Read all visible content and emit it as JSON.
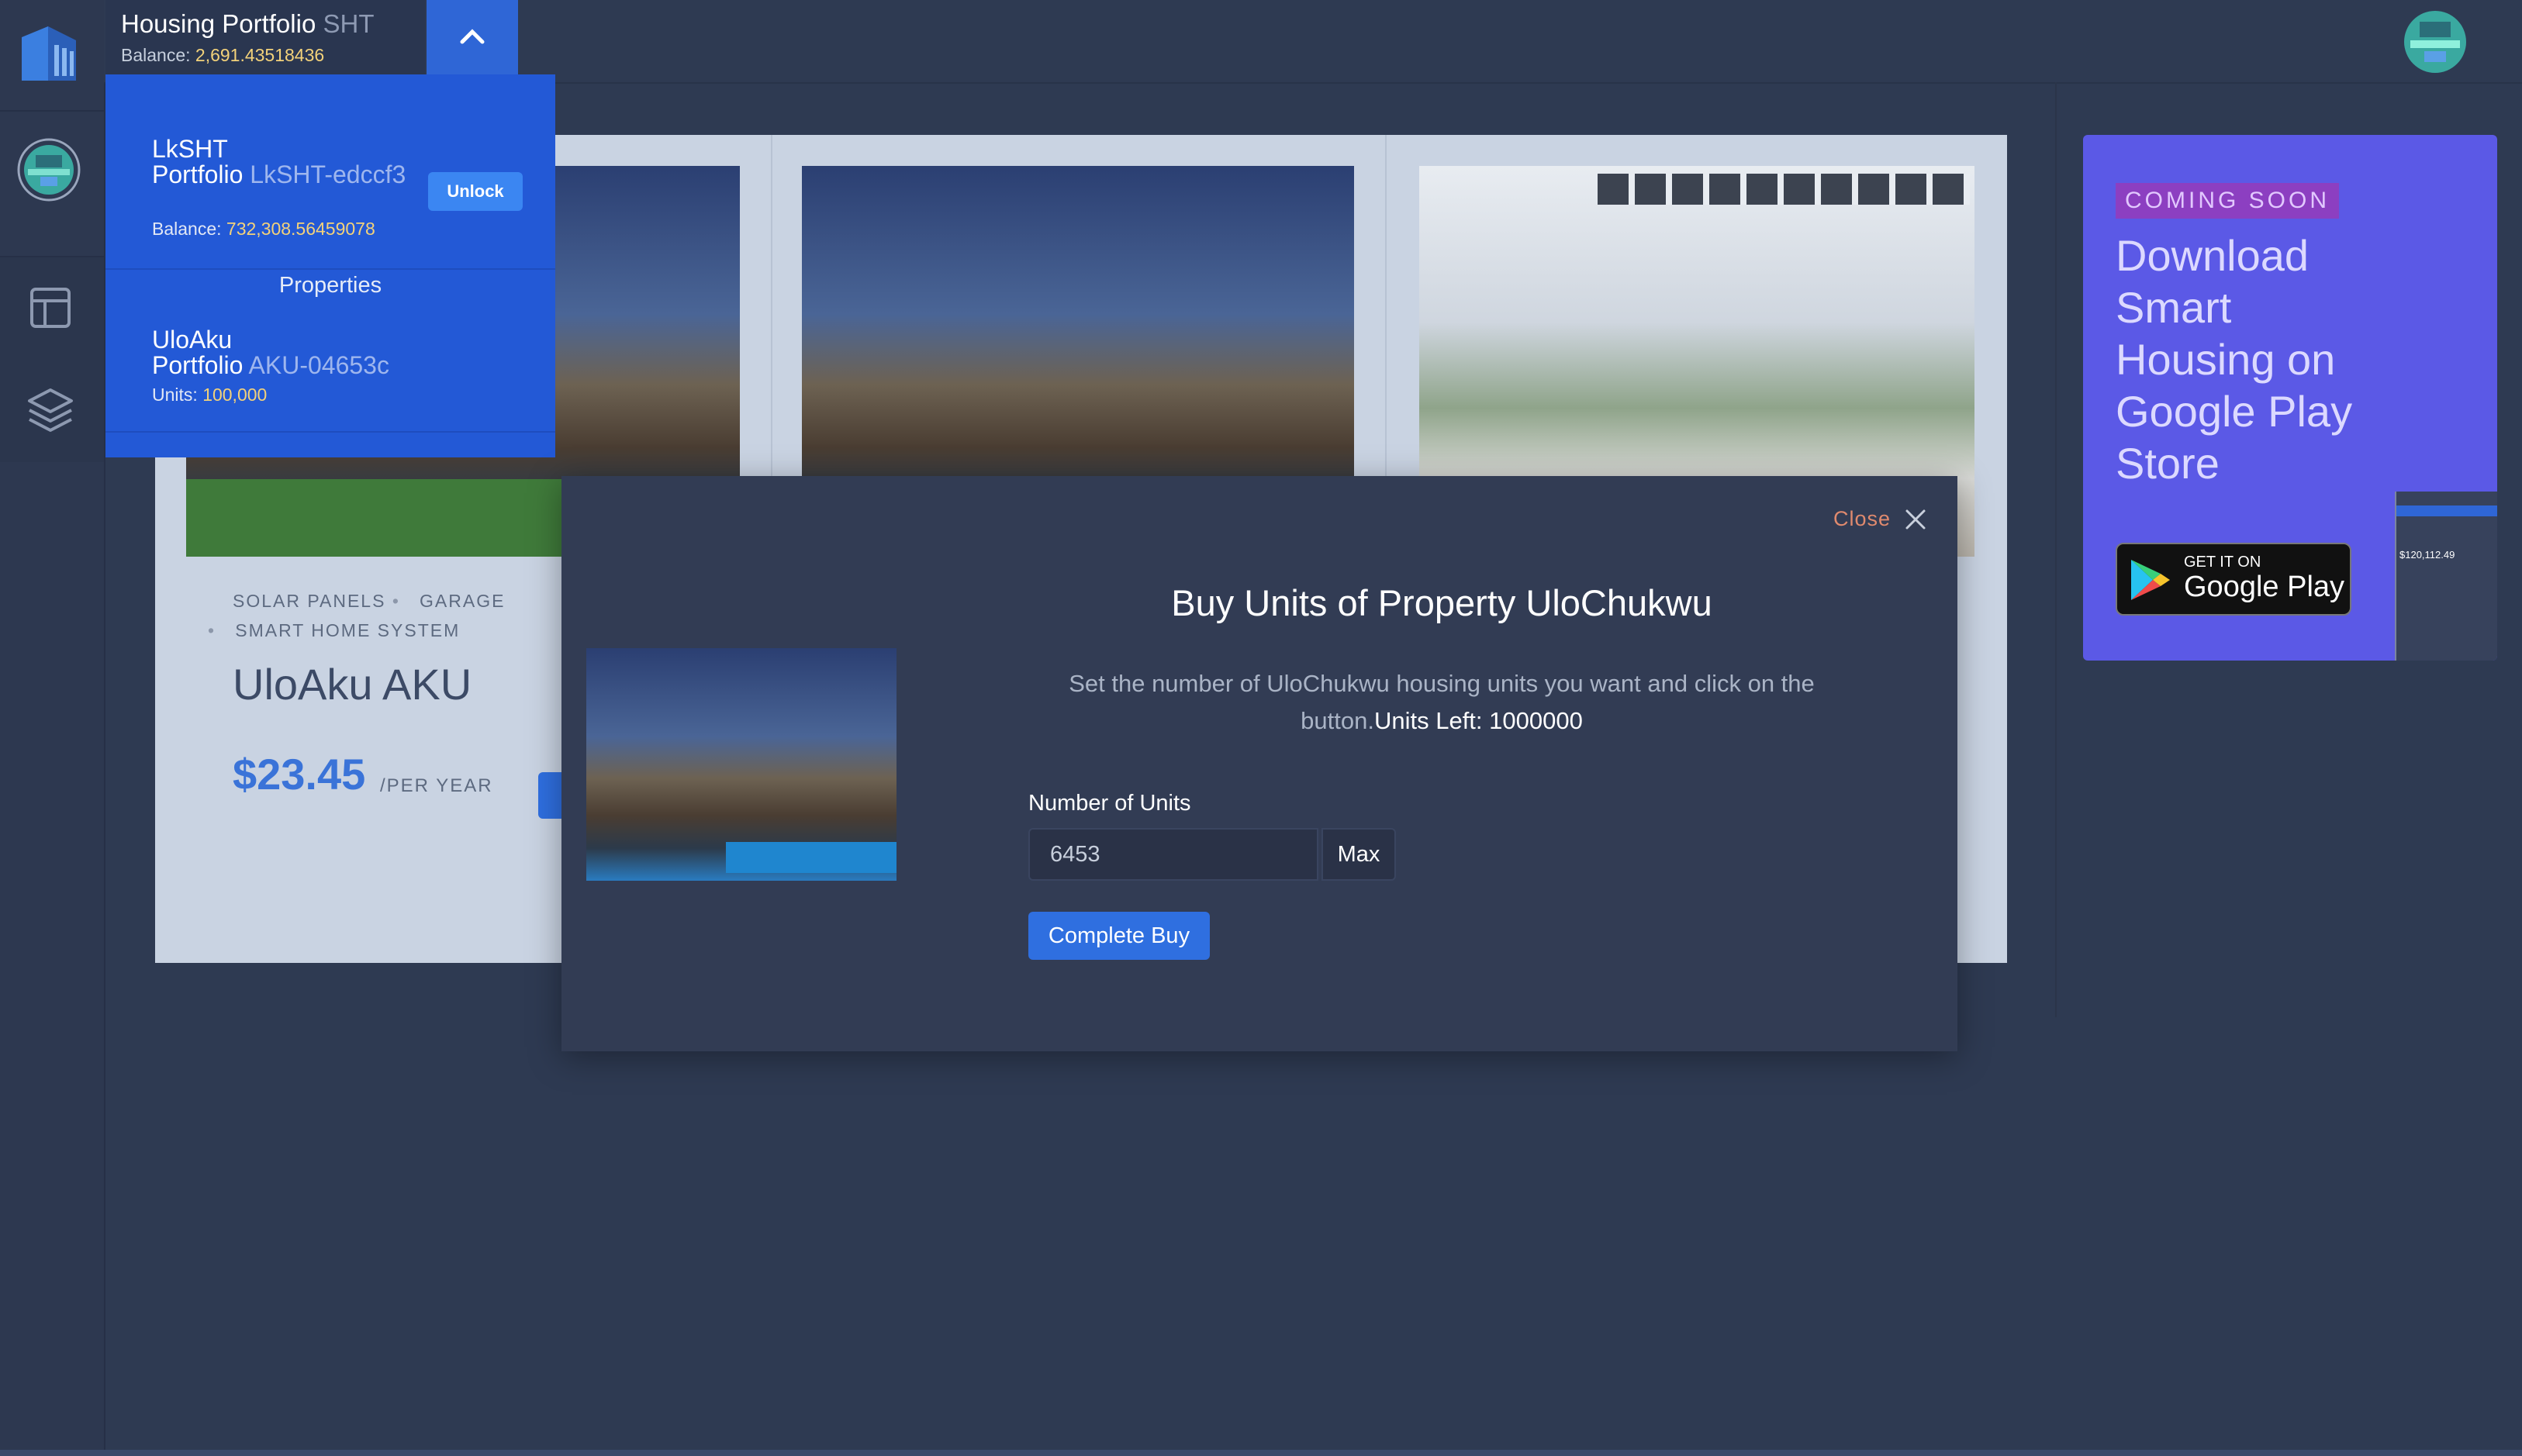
{
  "header": {
    "portfolio_name": "Housing Portfolio",
    "portfolio_code": "SHT",
    "balance_label": "Balance:",
    "balance_value": "2,691.43518436"
  },
  "dropdown": {
    "portfolio1": {
      "name_line1": "LkSHT",
      "name_line2": "Portfolio",
      "code": "LkSHT-edccf3",
      "balance_label": "Balance:",
      "balance_value": "732,308.56459078",
      "unlock_label": "Unlock"
    },
    "section_title": "Properties",
    "portfolio2": {
      "name_line1": "UloAku",
      "name_line2": "Portfolio",
      "code": "AKU-04653c",
      "units_label": "Units:",
      "units_value": "100,000"
    }
  },
  "card": {
    "features_line1a": "SOLAR PANELS",
    "features_line1b": "GARAGE",
    "features_line2": "SMART HOME SYSTEM",
    "title": "UloAku AKU",
    "price": "$23.45",
    "price_suffix": "/PER YEAR"
  },
  "modal": {
    "close_label": "Close",
    "title": "Buy Units of Property UloChukwu",
    "description": "Set the number of UloChukwu housing units you want and click on the button.",
    "units_left": "Units Left: 1000000",
    "field_label": "Number of Units",
    "field_value": "6453",
    "max_label": "Max",
    "submit_label": "Complete Buy"
  },
  "ad": {
    "badge": "COMING SOON",
    "headline_1": "Download",
    "headline_2": "Smart",
    "headline_3": "Housing on",
    "headline_4": "Google Play",
    "headline_5": "Store",
    "store_small": "GET IT ON",
    "store_big": "Google Play",
    "preview_amount": "$120,112.49"
  },
  "colors": {
    "background": "#2e3a52",
    "primary": "#2f6fe0",
    "dropdown": "#2359d6",
    "modal": "#323c54",
    "balance": "#f3d27a",
    "price": "#3a73d8",
    "close": "#e08a6e",
    "ad": "#5b59e6",
    "badge": "#8c3fc1"
  },
  "icons": [
    "app-logo-icon",
    "avatar-icon",
    "layout-icon",
    "layers-icon",
    "chevron-up-icon",
    "close-icon",
    "google-play-icon"
  ]
}
